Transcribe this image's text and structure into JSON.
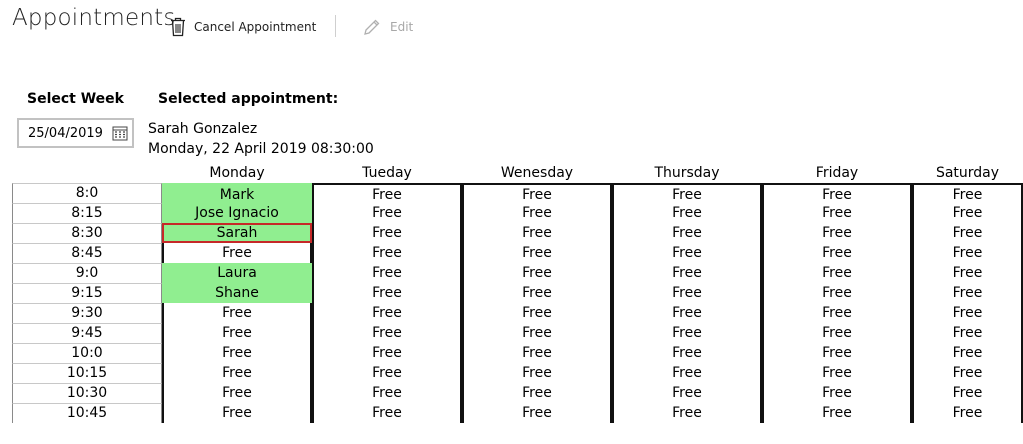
{
  "page": {
    "title": "Appointments"
  },
  "toolbar": {
    "cancel_label": "Cancel Appointment",
    "edit_label": "Edit"
  },
  "select_week": {
    "label": "Select Week",
    "date_value": "25/04/2019"
  },
  "selected_appointment": {
    "label": "Selected appointment:",
    "name": "Sarah Gonzalez",
    "datetime": "Monday, 22 April 2019 08:30:00"
  },
  "colors": {
    "booked": "#90ee90",
    "selected_border": "#c62828"
  },
  "schedule": {
    "days": [
      "Monday",
      "Tueday",
      "Wenesday",
      "Thursday",
      "Friday",
      "Saturday"
    ],
    "times": [
      "8:0",
      "8:15",
      "8:30",
      "8:45",
      "9:0",
      "9:15",
      "9:30",
      "9:45",
      "10:0",
      "10:15",
      "10:30",
      "10:45"
    ],
    "monday": [
      "Mark",
      "Jose Ignacio",
      "Sarah",
      "Free",
      "Laura",
      "Shane",
      "Free",
      "Free",
      "Free",
      "Free",
      "Free",
      "Free"
    ],
    "booked_monday_slots": [
      0,
      1,
      2,
      4,
      5
    ],
    "selected_slot": {
      "day": "Monday",
      "time": "8:30"
    },
    "free_label": "Free"
  }
}
